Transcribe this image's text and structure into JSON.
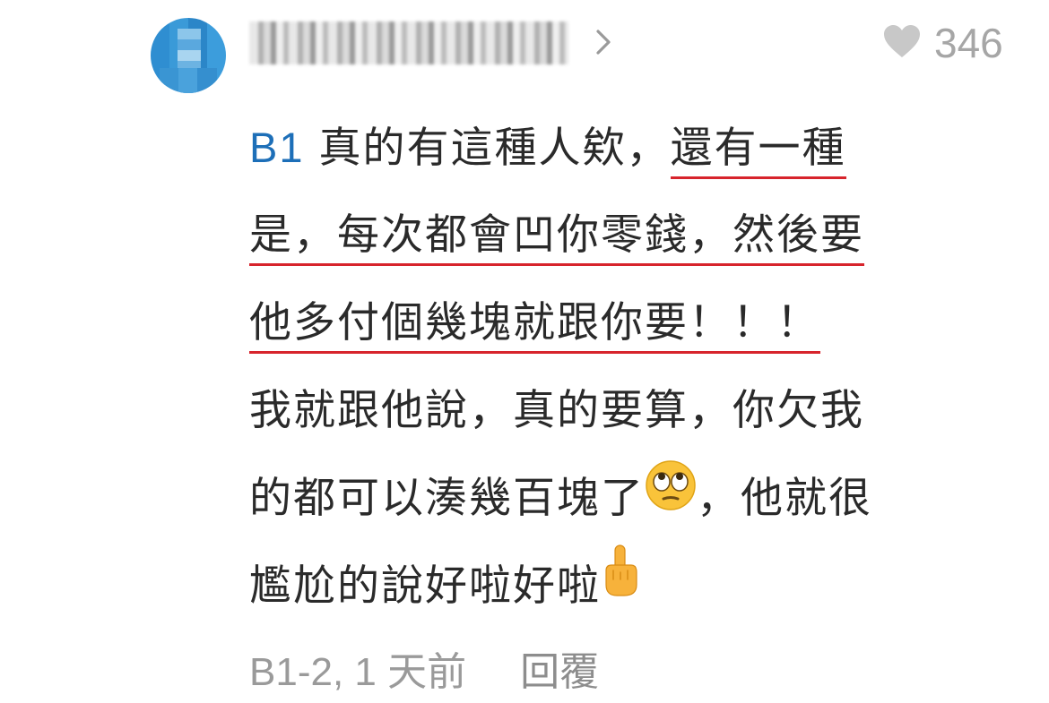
{
  "comment": {
    "like_count": "346",
    "floor_label": "B1",
    "lines": {
      "l1_text": "真的有這種人欸，",
      "l1_underlined": "還有一種",
      "l2_underlined": "是，每次都會凹你零錢，然後要",
      "l3_underlined": "他多付個幾塊就跟你要！！！",
      "l4": "我就跟他說，真的要算，你欠我",
      "l5_before_emoji": "的都可以湊幾百塊了",
      "l5_after_emoji": "，他就很",
      "l6_before_emoji": "尷尬的說好啦好啦"
    },
    "footer": {
      "meta": "B1-2, 1 天前",
      "reply_label": "回覆"
    },
    "colors": {
      "floor": "#1d6fb8",
      "underline": "#d7242c",
      "meta": "#9a9a9a",
      "like": "#c8c8c8"
    },
    "icons": {
      "chevron": "chevron-right-icon",
      "like": "heart-icon",
      "emoji_1": "face-with-rolling-eyes-emoji",
      "emoji_2": "pointing-up-finger-emoji"
    }
  }
}
